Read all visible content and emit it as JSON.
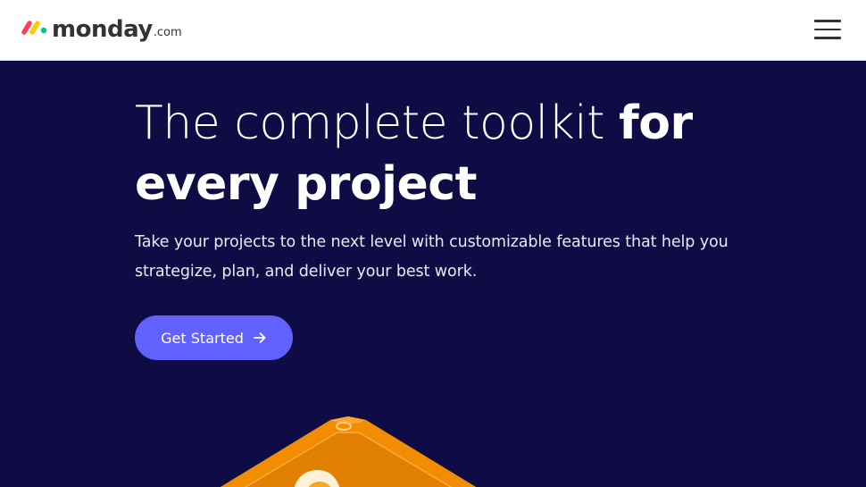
{
  "header": {
    "logo": {
      "word": "monday",
      "tld": ".com",
      "mark_colors": [
        "#ff3d57",
        "#ffcb00",
        "#00ca72"
      ]
    },
    "menu_icon": "hamburger-menu-icon"
  },
  "hero": {
    "headline_light": "The complete toolkit ",
    "headline_bold": "for every project",
    "subtitle": "Take your projects to the next level with customizable features that help you strategize, plan, and deliver your best work.",
    "cta_label": "Get Started",
    "cta_icon": "arrow-right-icon",
    "illustration": "orange-isometric-board-illustration"
  },
  "colors": {
    "hero_bg": "#0f0c45",
    "cta_bg": "#6161ff",
    "header_bg": "#ffffff",
    "illustration_orange": "#f28c00"
  }
}
